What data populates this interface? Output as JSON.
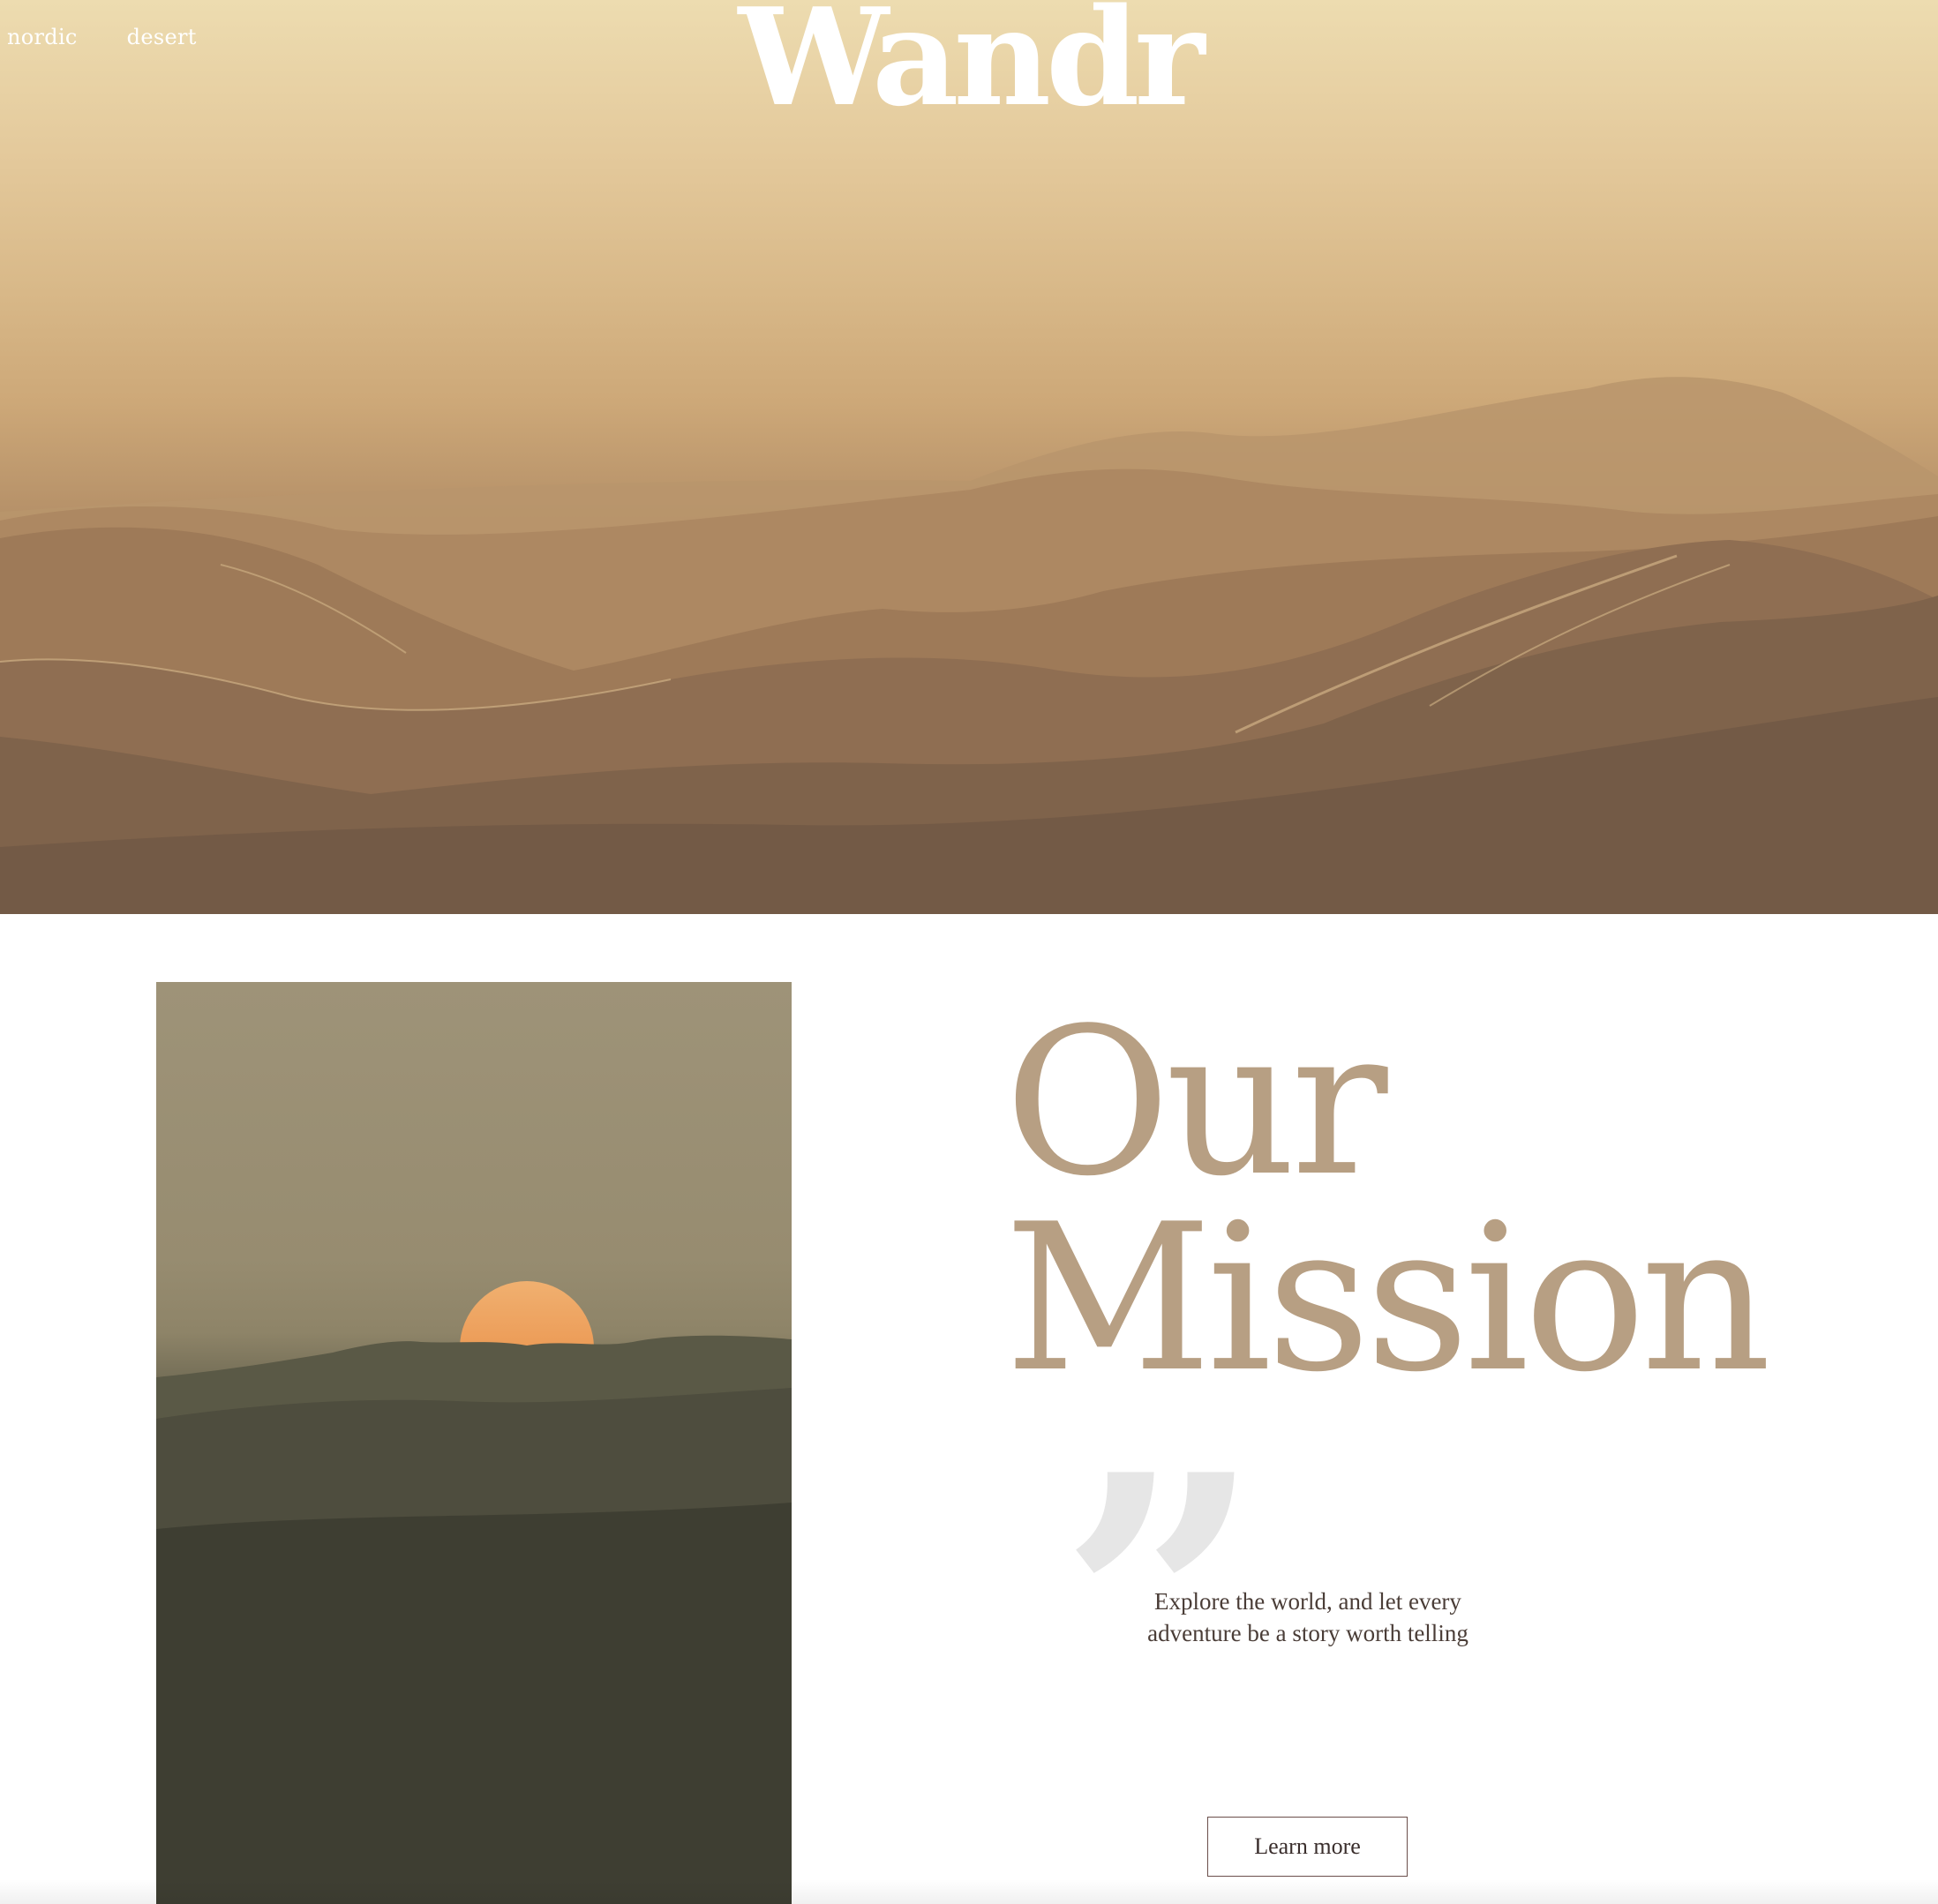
{
  "brand": {
    "logo": "Wandr"
  },
  "nav": {
    "items": [
      "nordic",
      "desert"
    ]
  },
  "hero": {
    "image": "desert-dunes"
  },
  "mission": {
    "title_line1": "Our",
    "title_line2": "Mission",
    "image": "sunset-over-hills",
    "quote_icon": "quote-icon",
    "quote_text": "Explore the world, and let every adventure be a story worth telling",
    "cta_label": "Learn more"
  },
  "colors": {
    "title": "#b79f83",
    "quote_mark": "#e6e6e6",
    "text_dark": "#4a3d37",
    "button_border": "#6b4f4b"
  }
}
